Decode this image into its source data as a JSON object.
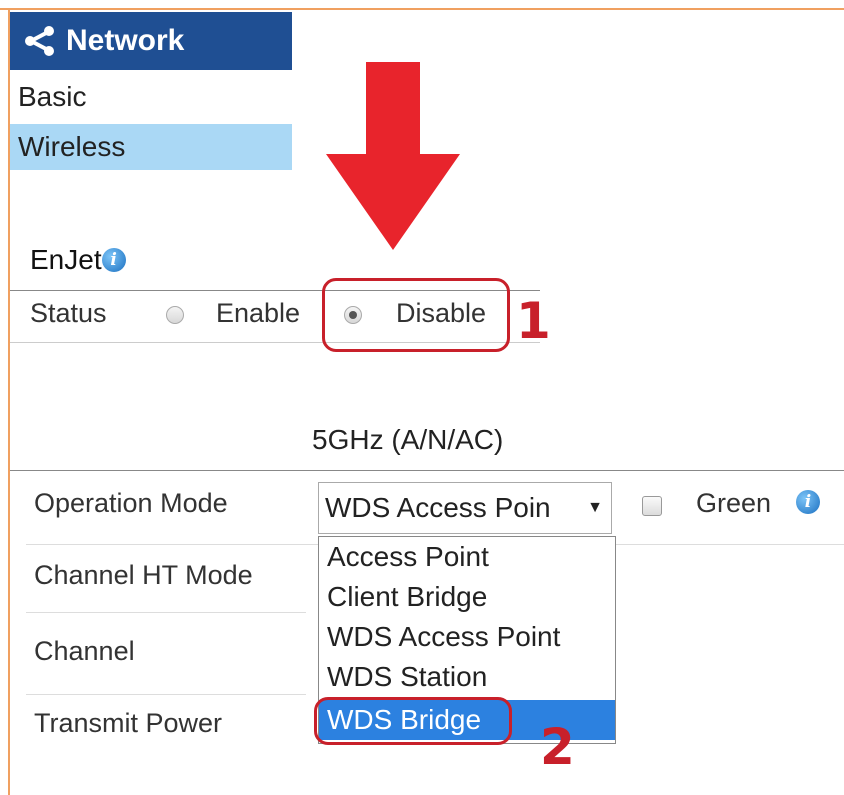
{
  "sidebar": {
    "header": "Network",
    "items": [
      {
        "label": "Basic"
      },
      {
        "label": "Wireless"
      }
    ]
  },
  "enjet": {
    "title": "EnJet",
    "status_label": "Status",
    "enable_label": "Enable",
    "disable_label": "Disable",
    "selected": "Disable"
  },
  "wireless_5ghz": {
    "section_title": "5GHz (A/N/AC)",
    "operation_mode_label": "Operation Mode",
    "operation_mode_value": "WDS Access Poin",
    "green_label": "Green",
    "channel_ht_mode_label": "Channel HT Mode",
    "channel_label": "Channel",
    "transmit_power_label": "Transmit Power",
    "options": [
      "Access Point",
      "Client Bridge",
      "WDS Access Point",
      "WDS Station",
      "WDS Bridge"
    ],
    "highlighted_option": "WDS Bridge"
  },
  "annotations": {
    "marker_1": "1",
    "marker_2": "2"
  },
  "colors": {
    "nav_header_bg": "#1f4f93",
    "nav_selected_bg": "#aad8f5",
    "option_highlight": "#2c81e0",
    "callout_red": "#c8202a"
  }
}
